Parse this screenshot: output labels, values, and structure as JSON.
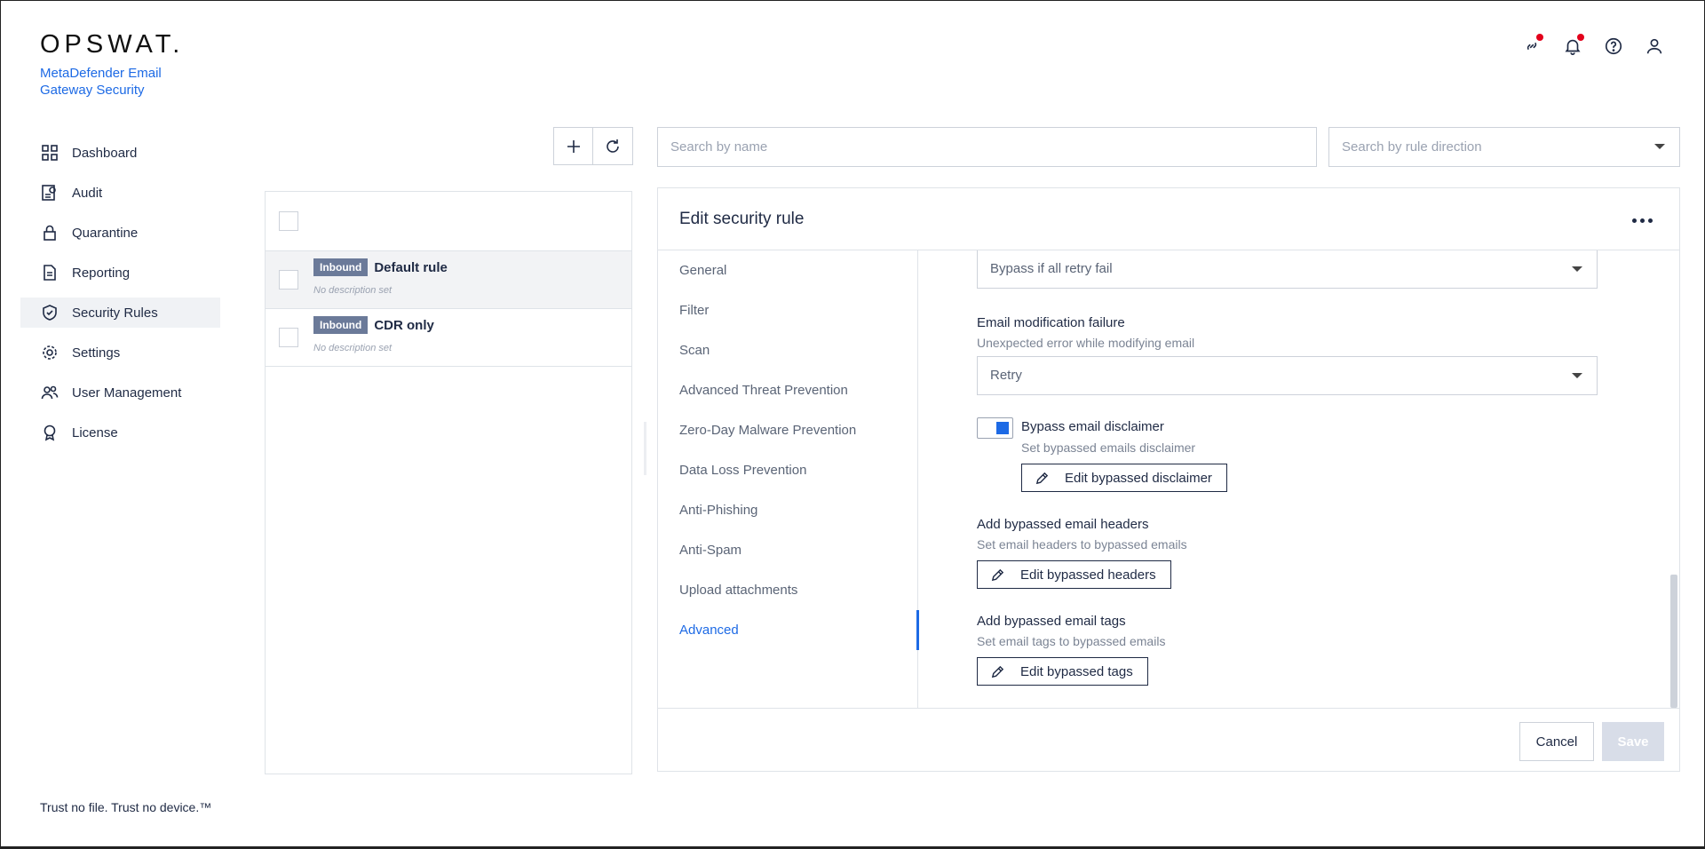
{
  "brand": {
    "logo": "OPSWAT.",
    "product": "MetaDefender Email Gateway Security"
  },
  "top_icons": [
    "link-icon",
    "bell-icon",
    "help-icon",
    "user-icon"
  ],
  "sidebar": {
    "items": [
      {
        "label": "Dashboard",
        "icon": "dashboard-icon"
      },
      {
        "label": "Audit",
        "icon": "audit-icon"
      },
      {
        "label": "Quarantine",
        "icon": "lock-icon"
      },
      {
        "label": "Reporting",
        "icon": "document-icon"
      },
      {
        "label": "Security Rules",
        "icon": "shield-check-icon"
      },
      {
        "label": "Settings",
        "icon": "gear-icon"
      },
      {
        "label": "User Management",
        "icon": "users-icon"
      },
      {
        "label": "License",
        "icon": "award-icon"
      }
    ],
    "active": "Security Rules"
  },
  "tagline": "Trust no file. Trust no device.™",
  "search": {
    "name_placeholder": "Search by name",
    "direction_placeholder": "Search by rule direction"
  },
  "rules": [
    {
      "badge": "Inbound",
      "name": "Default rule",
      "desc": "No description set"
    },
    {
      "badge": "Inbound",
      "name": "CDR only",
      "desc": "No description set"
    }
  ],
  "edit": {
    "title": "Edit security rule",
    "tabs": [
      "General",
      "Filter",
      "Scan",
      "Advanced Threat Prevention",
      "Zero-Day Malware Prevention",
      "Data Loss Prevention",
      "Anti-Phishing",
      "Anti-Spam",
      "Upload attachments",
      "Advanced"
    ],
    "active_tab": "Advanced",
    "top_select": "Bypass if all retry fail",
    "mod_failure": {
      "label": "Email modification failure",
      "sub": "Unexpected error while modifying email",
      "value": "Retry"
    },
    "disclaimer": {
      "label": "Bypass email disclaimer",
      "sub": "Set bypassed emails disclaimer",
      "button": "Edit bypassed disclaimer",
      "enabled": true
    },
    "headers": {
      "label": "Add bypassed email headers",
      "sub": "Set email headers to bypassed emails",
      "button": "Edit bypassed headers"
    },
    "tags": {
      "label": "Add bypassed email tags",
      "sub": "Set email tags to bypassed emails",
      "button": "Edit bypassed tags"
    },
    "cancel": "Cancel",
    "save": "Save"
  },
  "colors": {
    "accent": "#1d6ae5",
    "badge": "#6b7a99",
    "notify": "#e3001b"
  }
}
